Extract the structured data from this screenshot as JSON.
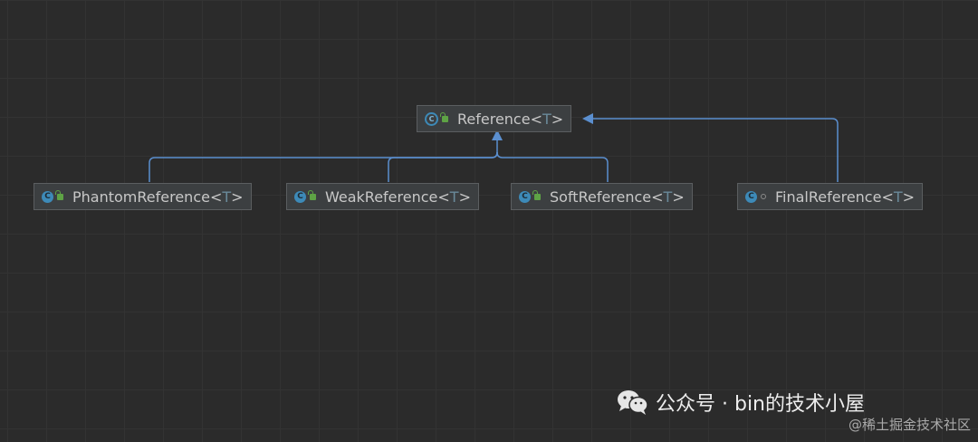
{
  "diagram": {
    "nodes": [
      {
        "id": "reference",
        "name": "Reference",
        "open": "<",
        "type_param": "T",
        "close": ">",
        "icon": "abstract-class-icon",
        "visibility": "public"
      },
      {
        "id": "phantom",
        "name": "PhantomReference",
        "open": "<",
        "type_param": "T",
        "close": ">",
        "icon": "class-icon",
        "visibility": "public"
      },
      {
        "id": "weak",
        "name": "WeakReference",
        "open": "<",
        "type_param": "T",
        "close": ">",
        "icon": "class-icon",
        "visibility": "public"
      },
      {
        "id": "soft",
        "name": "SoftReference",
        "open": "<",
        "type_param": "T",
        "close": ">",
        "icon": "class-icon",
        "visibility": "public"
      },
      {
        "id": "final",
        "name": "FinalReference",
        "open": "<",
        "type_param": "T",
        "close": ">",
        "icon": "class-icon",
        "visibility": "package-private"
      }
    ],
    "edges": [
      {
        "from": "phantom",
        "to": "reference",
        "kind": "extends"
      },
      {
        "from": "weak",
        "to": "reference",
        "kind": "extends"
      },
      {
        "from": "soft",
        "to": "reference",
        "kind": "extends"
      },
      {
        "from": "final",
        "to": "reference",
        "kind": "extends"
      }
    ],
    "edge_color": "#5b8fcf"
  },
  "watermark": {
    "main": "公众号 · bin的技术小屋",
    "sub": "@稀土掘金技术社区"
  }
}
